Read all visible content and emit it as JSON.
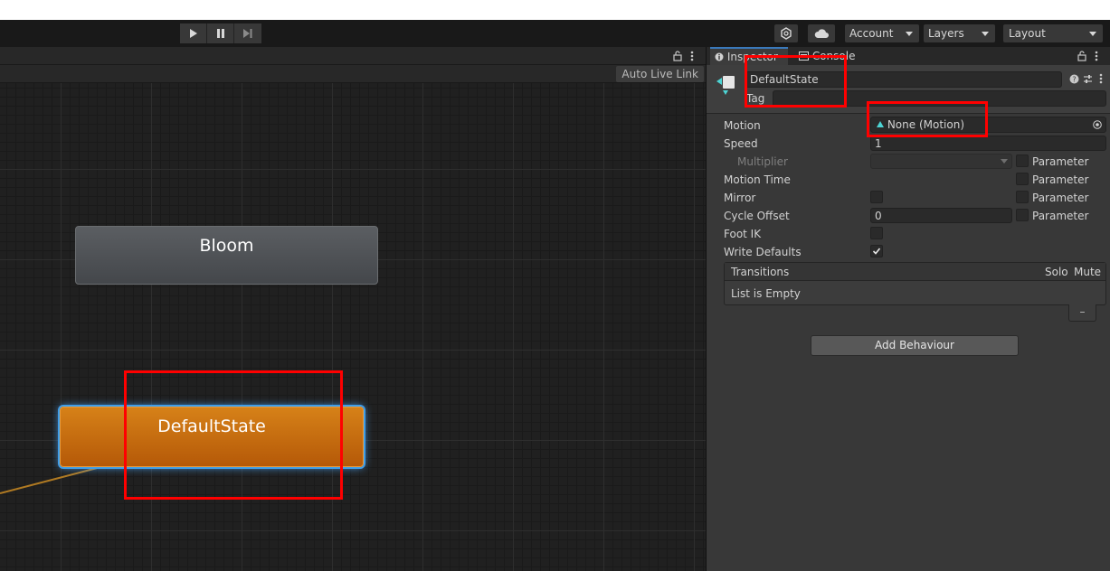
{
  "toolbar": {
    "account": "Account",
    "layers": "Layers",
    "layout": "Layout"
  },
  "graph": {
    "auto_live_link": "Auto Live Link",
    "nodes": {
      "bloom": "Bloom",
      "default_state": "DefaultState"
    }
  },
  "inspector": {
    "tabs": {
      "inspector": "Inspector",
      "console": "Console"
    },
    "name_value": "DefaultState",
    "tag_label": "Tag",
    "tag_value": "",
    "rows": {
      "motion": {
        "label": "Motion",
        "value": "None (Motion)"
      },
      "speed": {
        "label": "Speed",
        "value": "1"
      },
      "multiplier": {
        "label": "Multiplier",
        "value": ""
      },
      "motion_time": {
        "label": "Motion Time"
      },
      "mirror": {
        "label": "Mirror"
      },
      "cycle_offset": {
        "label": "Cycle Offset",
        "value": "0"
      },
      "foot_ik": {
        "label": "Foot IK"
      },
      "write_defaults": {
        "label": "Write Defaults",
        "checked": true
      }
    },
    "parameter_label": "Parameter",
    "transitions": {
      "header": "Transitions",
      "solo": "Solo",
      "mute": "Mute",
      "empty_text": "List is Empty",
      "remove_symbol": "–"
    },
    "add_behaviour": "Add Behaviour"
  },
  "colors": {
    "default_state_node": "#c76c10",
    "selection_glow": "#3f9ee9",
    "annotation_red": "#ff0000",
    "motion_icon": "#4dd4d4"
  }
}
